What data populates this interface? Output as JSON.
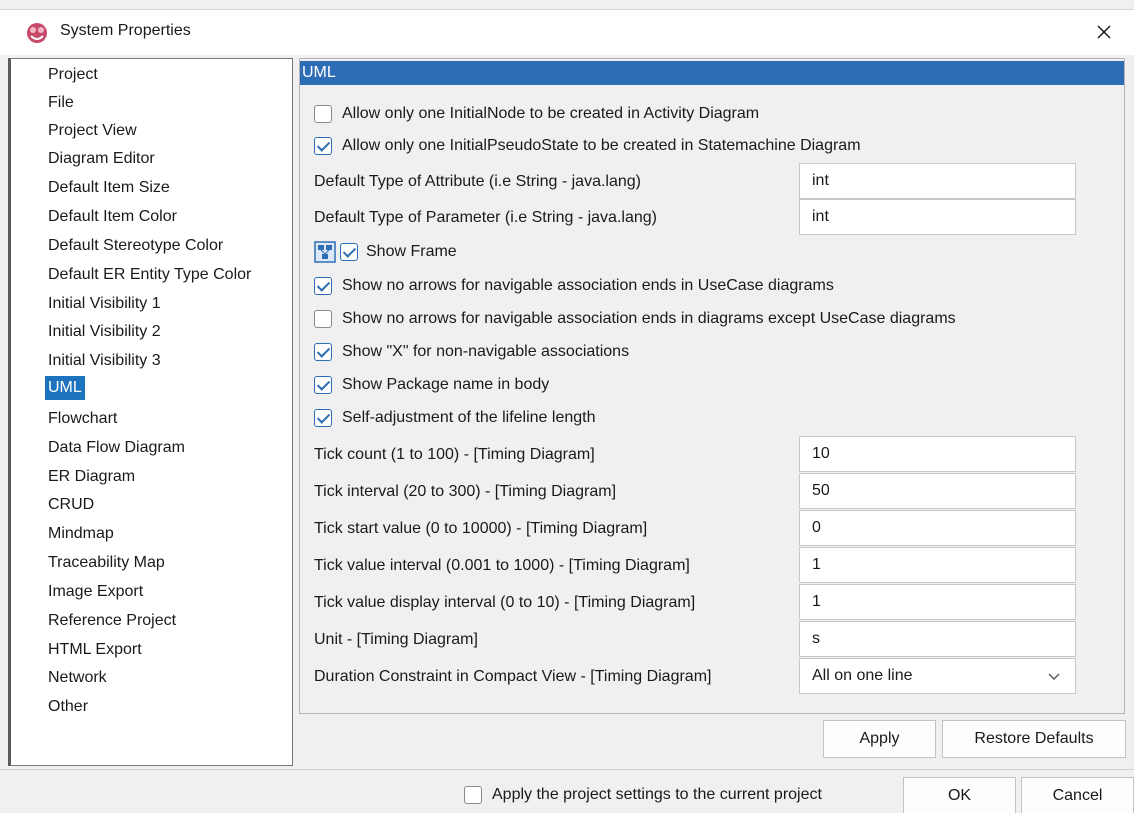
{
  "window": {
    "title": "System Properties"
  },
  "sidebar": {
    "items": [
      {
        "label": "Project"
      },
      {
        "label": "File"
      },
      {
        "label": "Project View"
      },
      {
        "label": "Diagram Editor"
      },
      {
        "label": "Default Item Size"
      },
      {
        "label": "Default Item Color"
      },
      {
        "label": "Default Stereotype Color"
      },
      {
        "label": "Default ER Entity Type Color"
      },
      {
        "label": "Initial Visibility 1"
      },
      {
        "label": "Initial Visibility 2"
      },
      {
        "label": "Initial Visibility 3"
      },
      {
        "label": "UML",
        "selected": true
      },
      {
        "label": "Flowchart"
      },
      {
        "label": "Data Flow Diagram"
      },
      {
        "label": "ER Diagram"
      },
      {
        "label": "CRUD"
      },
      {
        "label": "Mindmap"
      },
      {
        "label": "Traceability Map"
      },
      {
        "label": "Image Export"
      },
      {
        "label": "Reference Project"
      },
      {
        "label": "HTML Export"
      },
      {
        "label": "Network"
      },
      {
        "label": "Other"
      }
    ]
  },
  "panel": {
    "header": "UML",
    "checkboxes_top": [
      {
        "label": "Allow only one InitialNode to be created in Activity Diagram",
        "checked": false
      },
      {
        "label": "Allow only one InitialPseudoState to be created in Statemachine Diagram",
        "checked": true
      }
    ],
    "fields_top": [
      {
        "label": "Default Type of Attribute (i.e String - java.lang)",
        "value": "int"
      },
      {
        "label": "Default Type of Parameter (i.e String - java.lang)",
        "value": "int"
      }
    ],
    "show_frame": {
      "label": "Show Frame",
      "checked": true,
      "icon": "frame-diagram-icon"
    },
    "checkboxes_mid": [
      {
        "label": "Show no arrows for navigable association ends in UseCase diagrams",
        "checked": true
      },
      {
        "label": "Show no arrows for navigable association ends in diagrams except UseCase diagrams",
        "checked": false
      },
      {
        "label": "Show \"X\" for non-navigable associations",
        "checked": true
      },
      {
        "label": "Show Package name in body",
        "checked": true
      },
      {
        "label": "Self-adjustment of the lifeline length",
        "checked": true
      }
    ],
    "timing_fields": [
      {
        "label": "Tick count (1 to 100) - [Timing Diagram]",
        "value": "10"
      },
      {
        "label": "Tick interval (20 to 300) - [Timing Diagram]",
        "value": "50"
      },
      {
        "label": "Tick start value (0 to 10000) - [Timing Diagram]",
        "value": "0"
      },
      {
        "label": "Tick value interval (0.001 to 1000) - [Timing Diagram]",
        "value": "1"
      },
      {
        "label": "Tick value display interval (0 to 10) - [Timing Diagram]",
        "value": "1"
      },
      {
        "label": "Unit - [Timing Diagram]",
        "value": "s"
      }
    ],
    "duration_constraint": {
      "label": "Duration Constraint in Compact View - [Timing Diagram]",
      "value": "All on one line"
    },
    "apply_label": "Apply",
    "restore_label": "Restore Defaults"
  },
  "footer": {
    "apply_project_label": "Apply the project settings to the current project",
    "apply_project_checked": false,
    "ok_label": "OK",
    "cancel_label": "Cancel"
  },
  "colors": {
    "accent": "#2d6db5",
    "selection": "#1e73be"
  }
}
